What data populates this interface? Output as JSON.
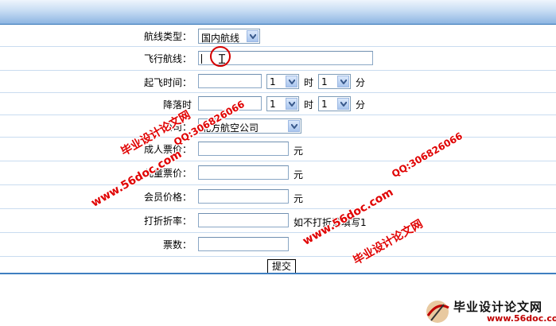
{
  "form": {
    "route_type": {
      "label": "航线类型：",
      "value": "国内航线"
    },
    "route": {
      "label": "飞行航线：",
      "value": ""
    },
    "depart": {
      "label": "起飞时间：",
      "date": "",
      "hour": "1",
      "hour_unit": "时",
      "minute": "1",
      "minute_unit": "分"
    },
    "arrive": {
      "label": "降落时",
      "date": "",
      "hour": "1",
      "hour_unit": "时",
      "minute": "1",
      "minute_unit": "分"
    },
    "airline": {
      "label": "公司：",
      "value": "北方航空公司"
    },
    "adult_price": {
      "label": "成人票价：",
      "value": "",
      "unit": "元"
    },
    "child_price": {
      "label": "儿童票价：",
      "value": "",
      "unit": "元"
    },
    "member_price": {
      "label": "会员价格：",
      "value": "",
      "unit": "元"
    },
    "discount": {
      "label": "打折折率：",
      "value": "",
      "hint": "如不打折请填写1"
    },
    "tickets": {
      "label": "票数：",
      "value": ""
    },
    "submit_label": "提交"
  },
  "watermark": {
    "site_name": "毕业设计论文网",
    "url": "www.56doc.com",
    "qq": "QQ:306826066"
  },
  "logo": {
    "title": "毕业设计论文网",
    "url": "www.56doc.com"
  },
  "colors": {
    "header_top": "#eef5fc",
    "header_bottom": "#8db5e2",
    "row_line": "#c9dcf0",
    "watermark": "#e00000"
  }
}
